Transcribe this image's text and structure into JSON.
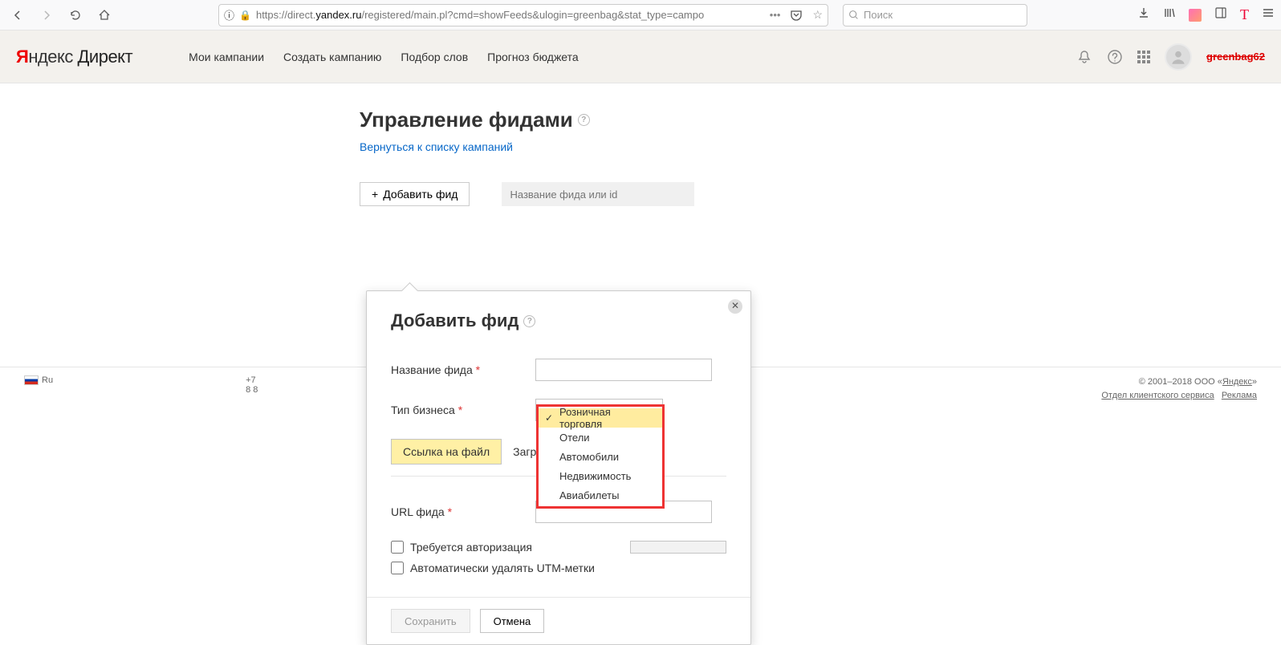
{
  "browser": {
    "url_prefix": "https://direct.",
    "url_domain": "yandex.ru",
    "url_rest": "/registered/main.pl?cmd=showFeeds&ulogin=greenbag&stat_type=campo",
    "search_placeholder": "Поиск"
  },
  "header": {
    "logo_ya": "Я",
    "logo_ndex": "ндекс",
    "logo_direct": " Директ",
    "nav": [
      "Мои кампании",
      "Создать кампанию",
      "Подбор слов",
      "Прогноз бюджета"
    ],
    "username": "greenbag62"
  },
  "page": {
    "title": "Управление фидами",
    "back_link": "Вернуться к списку кампаний",
    "add_feed_btn": "Добавить фид",
    "feed_search_placeholder": "Название фида или id"
  },
  "popup": {
    "title": "Добавить фид",
    "field_name_label": "Название фида",
    "field_type_label": "Тип бизнеса",
    "type_selected": "Розничная торговля",
    "tab_link": "Ссылка на файл",
    "tab_upload": "Загрузи",
    "url_label": "URL фида",
    "chk_auth": "Требуется авторизация",
    "chk_utm": "Автоматически удалять UTM-метки",
    "btn_save": "Сохранить",
    "btn_cancel": "Отмена"
  },
  "dropdown": {
    "options": [
      "Розничная торговля",
      "Отели",
      "Автомобили",
      "Недвижимость",
      "Авиабилеты"
    ]
  },
  "footer": {
    "lang": "Ru",
    "phone1": "+7",
    "phone2": "8 8",
    "copyright": "© 2001–2018  ООО «",
    "yandex_link": "Яндекс",
    "copyright_end": "»",
    "link1": "Отдел клиентского сервиса",
    "link2": "Реклама"
  }
}
